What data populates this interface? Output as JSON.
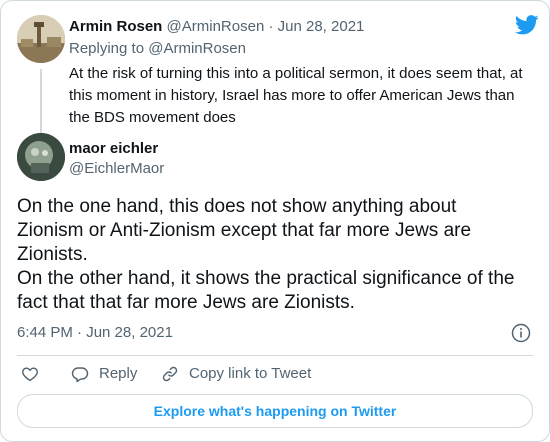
{
  "parent_tweet": {
    "name": "Armin Rosen",
    "handle": "@ArminRosen",
    "separator": "·",
    "date": "Jun 28, 2021",
    "replying_prefix": "Replying to",
    "replying_to": "@ArminRosen",
    "text": "At the risk of turning this into a political sermon, it does seem that, at this moment in history, Israel has more to offer American Jews than the BDS movement does"
  },
  "main_tweet": {
    "name": "maor eichler",
    "handle": "@EichlerMaor",
    "text": "On the one hand, this does not show anything about Zionism or Anti-Zionism except that far more Jews are Zionists.\nOn the other hand, it shows the practical significance of the fact that that far more Jews are Zionists.",
    "timestamp": "6:44 PM · Jun 28, 2021"
  },
  "actions": {
    "reply_label": "Reply",
    "copy_label": "Copy link to Tweet"
  },
  "explore_label": "Explore what's happening on Twitter",
  "colors": {
    "brand": "#1d9bf0",
    "text": "#0f1419",
    "muted": "#536471",
    "border": "#cfd9de"
  },
  "icons": [
    "twitter-bird-icon",
    "info-icon",
    "heart-icon",
    "reply-icon",
    "link-icon"
  ]
}
